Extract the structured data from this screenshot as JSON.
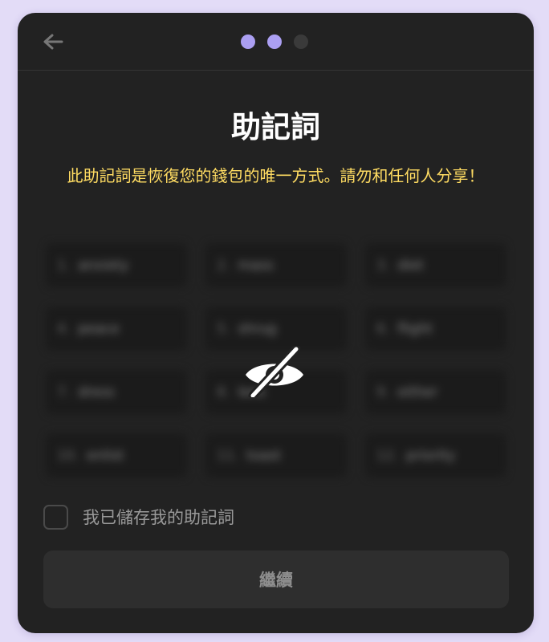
{
  "header": {
    "back_icon": "arrow-left-icon",
    "steps_total": 3,
    "steps_done": 2
  },
  "title": "助記詞",
  "subtitle": "此助記詞是恢復您的錢包的唯一方式。請勿和任何人分享！",
  "seed_words": [
    {
      "num": "1.",
      "word": "anxiety"
    },
    {
      "num": "2.",
      "word": "mass"
    },
    {
      "num": "3.",
      "word": "diet"
    },
    {
      "num": "4.",
      "word": "peace"
    },
    {
      "num": "5.",
      "word": "shrug"
    },
    {
      "num": "6.",
      "word": "flight"
    },
    {
      "num": "7.",
      "word": "dress"
    },
    {
      "num": "8.",
      "word": "lens"
    },
    {
      "num": "9.",
      "word": "either"
    },
    {
      "num": "10.",
      "word": "enlist"
    },
    {
      "num": "11.",
      "word": "toast"
    },
    {
      "num": "12.",
      "word": "priority"
    }
  ],
  "reveal_icon": "eye-slash-icon",
  "confirm_checkbox": {
    "label": "我已儲存我的助記詞",
    "checked": false
  },
  "continue_button": {
    "label": "繼續",
    "enabled": false
  },
  "colors": {
    "accent": "#ab9ff2",
    "warning": "#ffdc62",
    "panel": "#222222",
    "background": "#e3dcf7"
  }
}
